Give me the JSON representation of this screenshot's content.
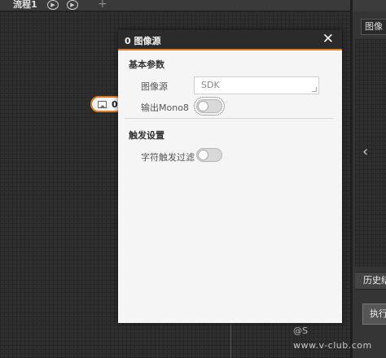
{
  "tab": {
    "label": "流程1",
    "run_once_icon": "play-circle-icon",
    "run_loop_icon": "play-loop-icon",
    "add_icon": "plus-icon"
  },
  "node": {
    "label": "0",
    "icon": "image-icon"
  },
  "dialog": {
    "title": "0 图像源",
    "close_icon": "close-icon",
    "basic_section": {
      "title": "基本参数",
      "image_source_label": "图像源",
      "image_source_value": "SDK",
      "mono8_label": "输出Mono8",
      "mono8_on": false
    },
    "trigger_section": {
      "title": "触发设置",
      "char_filter_label": "字符触发过滤",
      "char_filter_on": false
    }
  },
  "right_panel": {
    "field_text": "图像",
    "history_label": "历史结",
    "execute_label": "执行",
    "collapse_icon": "chevron-left-icon"
  },
  "watermark": {
    "at": "@S",
    "url": "www.v-club.com"
  },
  "colors": {
    "accent": "#e07b20",
    "header_bg": "#2b2b2b",
    "dialog_bg": "#f5f5f5"
  }
}
